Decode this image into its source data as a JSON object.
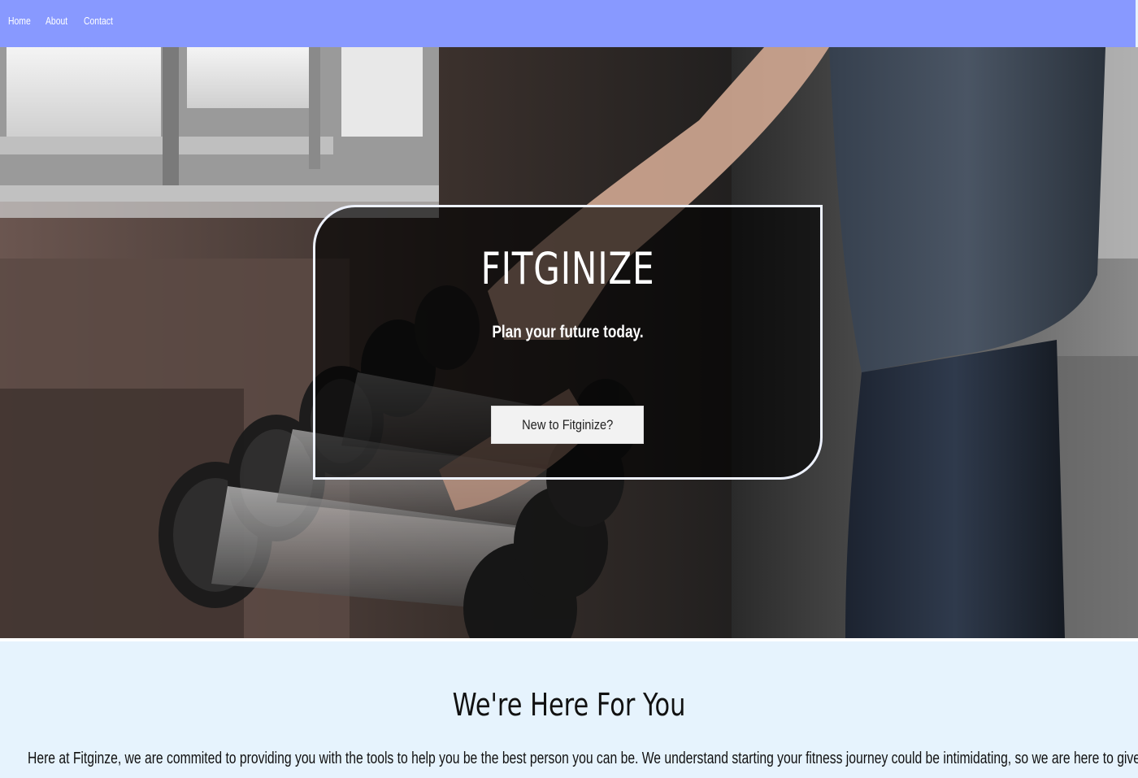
{
  "nav": {
    "items": [
      "Home",
      "About",
      "Contact"
    ],
    "background": "#8899ff"
  },
  "hero": {
    "title": "FITGINIZE",
    "tagline": "Plan your future today.",
    "button_label": "New to Fitginize?",
    "image_subject": "gym-dumbbells-photo"
  },
  "about": {
    "heading": "We're Here For You",
    "text": "Here at Fitginze, we are commited to providing you with the tools to help you be the best person you can be. We understand starting your fitness journey could be intimidating, so we are here to give you an",
    "background": "#e6f3fd"
  }
}
